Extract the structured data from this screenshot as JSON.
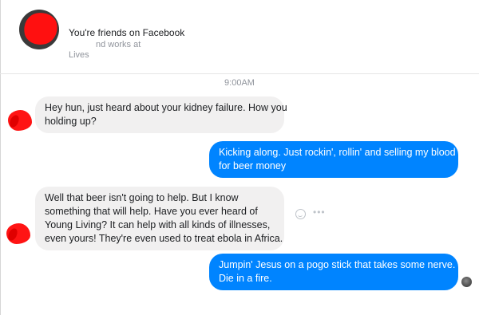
{
  "header": {
    "friends_text": "You're friends on Facebook",
    "works_text": "nd works at",
    "lives_text": "Lives"
  },
  "timestamp": "9:00AM",
  "messages": [
    {
      "direction": "incoming",
      "lines": [
        "Hey hun, just heard about your kidney failure.  How you",
        "holding up?"
      ]
    },
    {
      "direction": "outgoing",
      "lines": [
        "Kicking along.  Just rockin', rollin' and selling my blood",
        "for beer money"
      ]
    },
    {
      "direction": "incoming",
      "lines": [
        "Well that beer isn't going to help.  But I know",
        "something that will help.  Have you ever heard of",
        "Young Living?  It can help with all kinds of illnesses,",
        "even yours!  They're even used to treat ebola in Africa."
      ]
    },
    {
      "direction": "outgoing",
      "lines": [
        "Jumpin' Jesus on a pogo stick that takes some nerve.",
        "Die in a fire."
      ]
    }
  ],
  "message_actions": {
    "more_icon": "•••"
  },
  "colors": {
    "outgoing_bubble": "#0084ff",
    "incoming_bubble": "#f1f0f0",
    "timestamp_text": "#90949c"
  },
  "icons": [
    "redacted-profile-avatar",
    "emoji-reaction-icon",
    "more-options-icon",
    "read-receipt-avatar"
  ]
}
